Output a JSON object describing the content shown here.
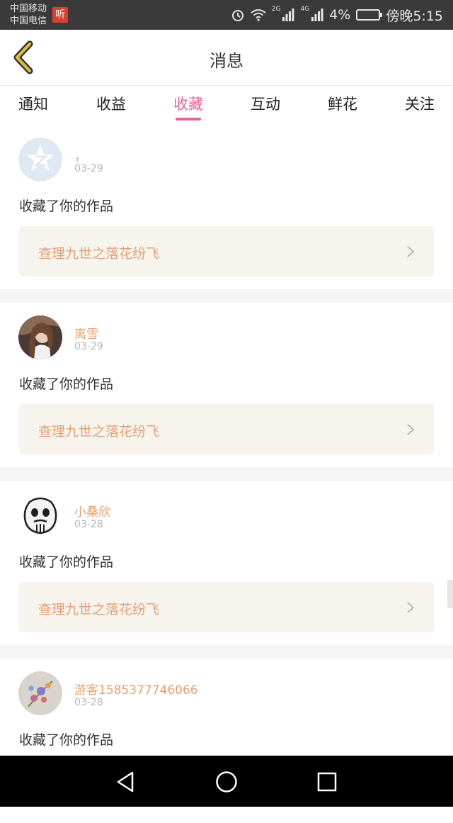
{
  "status_bar": {
    "carrier_1": "中国移动",
    "carrier_2": "中国电信",
    "app_badge": "听",
    "signal_1": "2G",
    "signal_2": "4G",
    "battery": "4%",
    "time": "傍晚5:15"
  },
  "header": {
    "title": "消息"
  },
  "tabs": [
    {
      "label": "通知"
    },
    {
      "label": "收益"
    },
    {
      "label": "收藏",
      "active": true
    },
    {
      "label": "互动"
    },
    {
      "label": "鲜花"
    },
    {
      "label": "关注"
    }
  ],
  "feed": [
    {
      "user": "，",
      "date": "03-29",
      "action": "收藏了你的作品",
      "work": "查理九世之落花纷飞"
    },
    {
      "user": "离雪",
      "date": "03-29",
      "action": "收藏了你的作品",
      "work": "查理九世之落花纷飞"
    },
    {
      "user": "小桑欣",
      "date": "03-28",
      "action": "收藏了你的作品",
      "work": "查理九世之落花纷飞"
    },
    {
      "user": "游客1585377746066",
      "date": "03-28",
      "action": "收藏了你的作品",
      "work": ""
    }
  ],
  "colors": {
    "accent": "#e2649b",
    "username": "#e8a070",
    "work_bg": "#f6f4ed",
    "work_text": "#e4a176"
  },
  "icons": {
    "back": "chevron-left-icon",
    "nav_back": "triangle-back-icon",
    "nav_home": "circle-home-icon",
    "nav_recent": "square-recent-icon"
  }
}
